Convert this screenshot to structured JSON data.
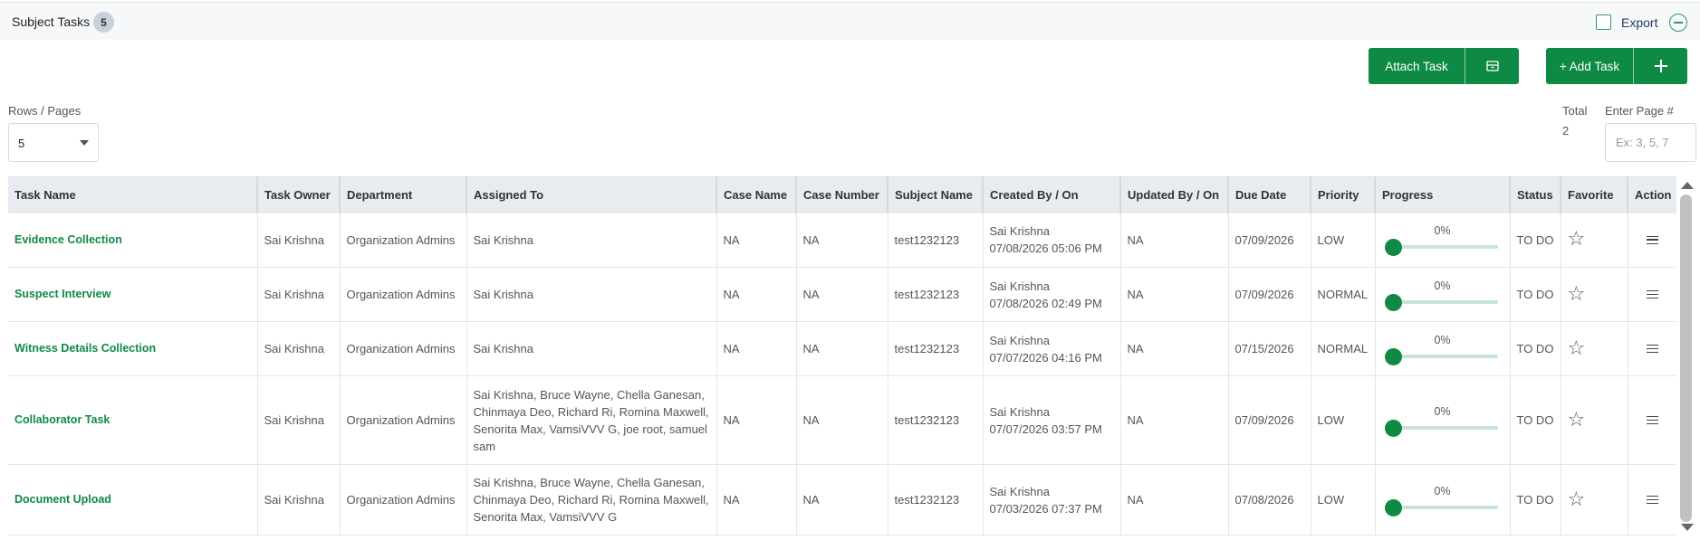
{
  "header": {
    "title": "Subject Tasks",
    "count": "5",
    "export_label": "Export"
  },
  "actions": {
    "attach_label": "Attach Task",
    "add_label": "+ Add Task"
  },
  "pagination": {
    "rows_label": "Rows / Pages",
    "rows_value": "5",
    "total_label": "Total",
    "total_value": "2",
    "page_label": "Enter Page #",
    "page_placeholder": "Ex: 3, 5, 7"
  },
  "table": {
    "columns": [
      "Task Name",
      "Task Owner",
      "Department",
      "Assigned To",
      "Case Name",
      "Case Number",
      "Subject Name",
      "Created By / On",
      "Updated By / On",
      "Due Date",
      "Priority",
      "Progress",
      "Status",
      "Favorite",
      "Action"
    ],
    "rows": [
      {
        "task": "Evidence Collection",
        "owner": "Sai Krishna",
        "dept": "Organization Admins",
        "assigned": "Sai Krishna",
        "case_name": "NA",
        "case_number": "NA",
        "subject": "test1232123",
        "created_by": "Sai Krishna",
        "created_on": "07/08/2026 05:06 PM",
        "updated": "NA",
        "due": "07/09/2026",
        "priority": "LOW",
        "progress": "0%",
        "status": "TO DO"
      },
      {
        "task": "Suspect Interview",
        "owner": "Sai Krishna",
        "dept": "Organization Admins",
        "assigned": "Sai Krishna",
        "case_name": "NA",
        "case_number": "NA",
        "subject": "test1232123",
        "created_by": "Sai Krishna",
        "created_on": "07/08/2026 02:49 PM",
        "updated": "NA",
        "due": "07/09/2026",
        "priority": "NORMAL",
        "progress": "0%",
        "status": "TO DO"
      },
      {
        "task": "Witness Details Collection",
        "owner": "Sai Krishna",
        "dept": "Organization Admins",
        "assigned": "Sai Krishna",
        "case_name": "NA",
        "case_number": "NA",
        "subject": "test1232123",
        "created_by": "Sai Krishna",
        "created_on": "07/07/2026 04:16 PM",
        "updated": "NA",
        "due": "07/15/2026",
        "priority": "NORMAL",
        "progress": "0%",
        "status": "TO DO"
      },
      {
        "task": "Collaborator Task",
        "owner": "Sai Krishna",
        "dept": "Organization Admins",
        "assigned": "Sai Krishna, Bruce Wayne, Chella Ganesan, Chinmaya Deo, Richard Ri, Romina Maxwell, Senorita Max, VamsiVVV G, joe root, samuel sam",
        "case_name": "NA",
        "case_number": "NA",
        "subject": "test1232123",
        "created_by": "Sai Krishna",
        "created_on": "07/07/2026 03:57 PM",
        "updated": "NA",
        "due": "07/09/2026",
        "priority": "LOW",
        "progress": "0%",
        "status": "TO DO"
      },
      {
        "task": "Document Upload",
        "owner": "Sai Krishna",
        "dept": "Organization Admins",
        "assigned": "Sai Krishna, Bruce Wayne, Chella Ganesan, Chinmaya Deo, Richard Ri, Romina Maxwell, Senorita Max, VamsiVVV G",
        "case_name": "NA",
        "case_number": "NA",
        "subject": "test1232123",
        "created_by": "Sai Krishna",
        "created_on": "07/03/2026 07:37 PM",
        "updated": "NA",
        "due": "07/08/2026",
        "priority": "LOW",
        "progress": "0%",
        "status": "TO DO"
      }
    ]
  },
  "icons": {
    "favorite": "star-outline-icon",
    "action": "hamburger-menu-icon",
    "attach": "archive-box-icon",
    "add": "plus-icon"
  },
  "colors": {
    "accent": "#0e8a45",
    "header_bg": "#e8ebef",
    "progress_track": "#c7e5d3"
  }
}
